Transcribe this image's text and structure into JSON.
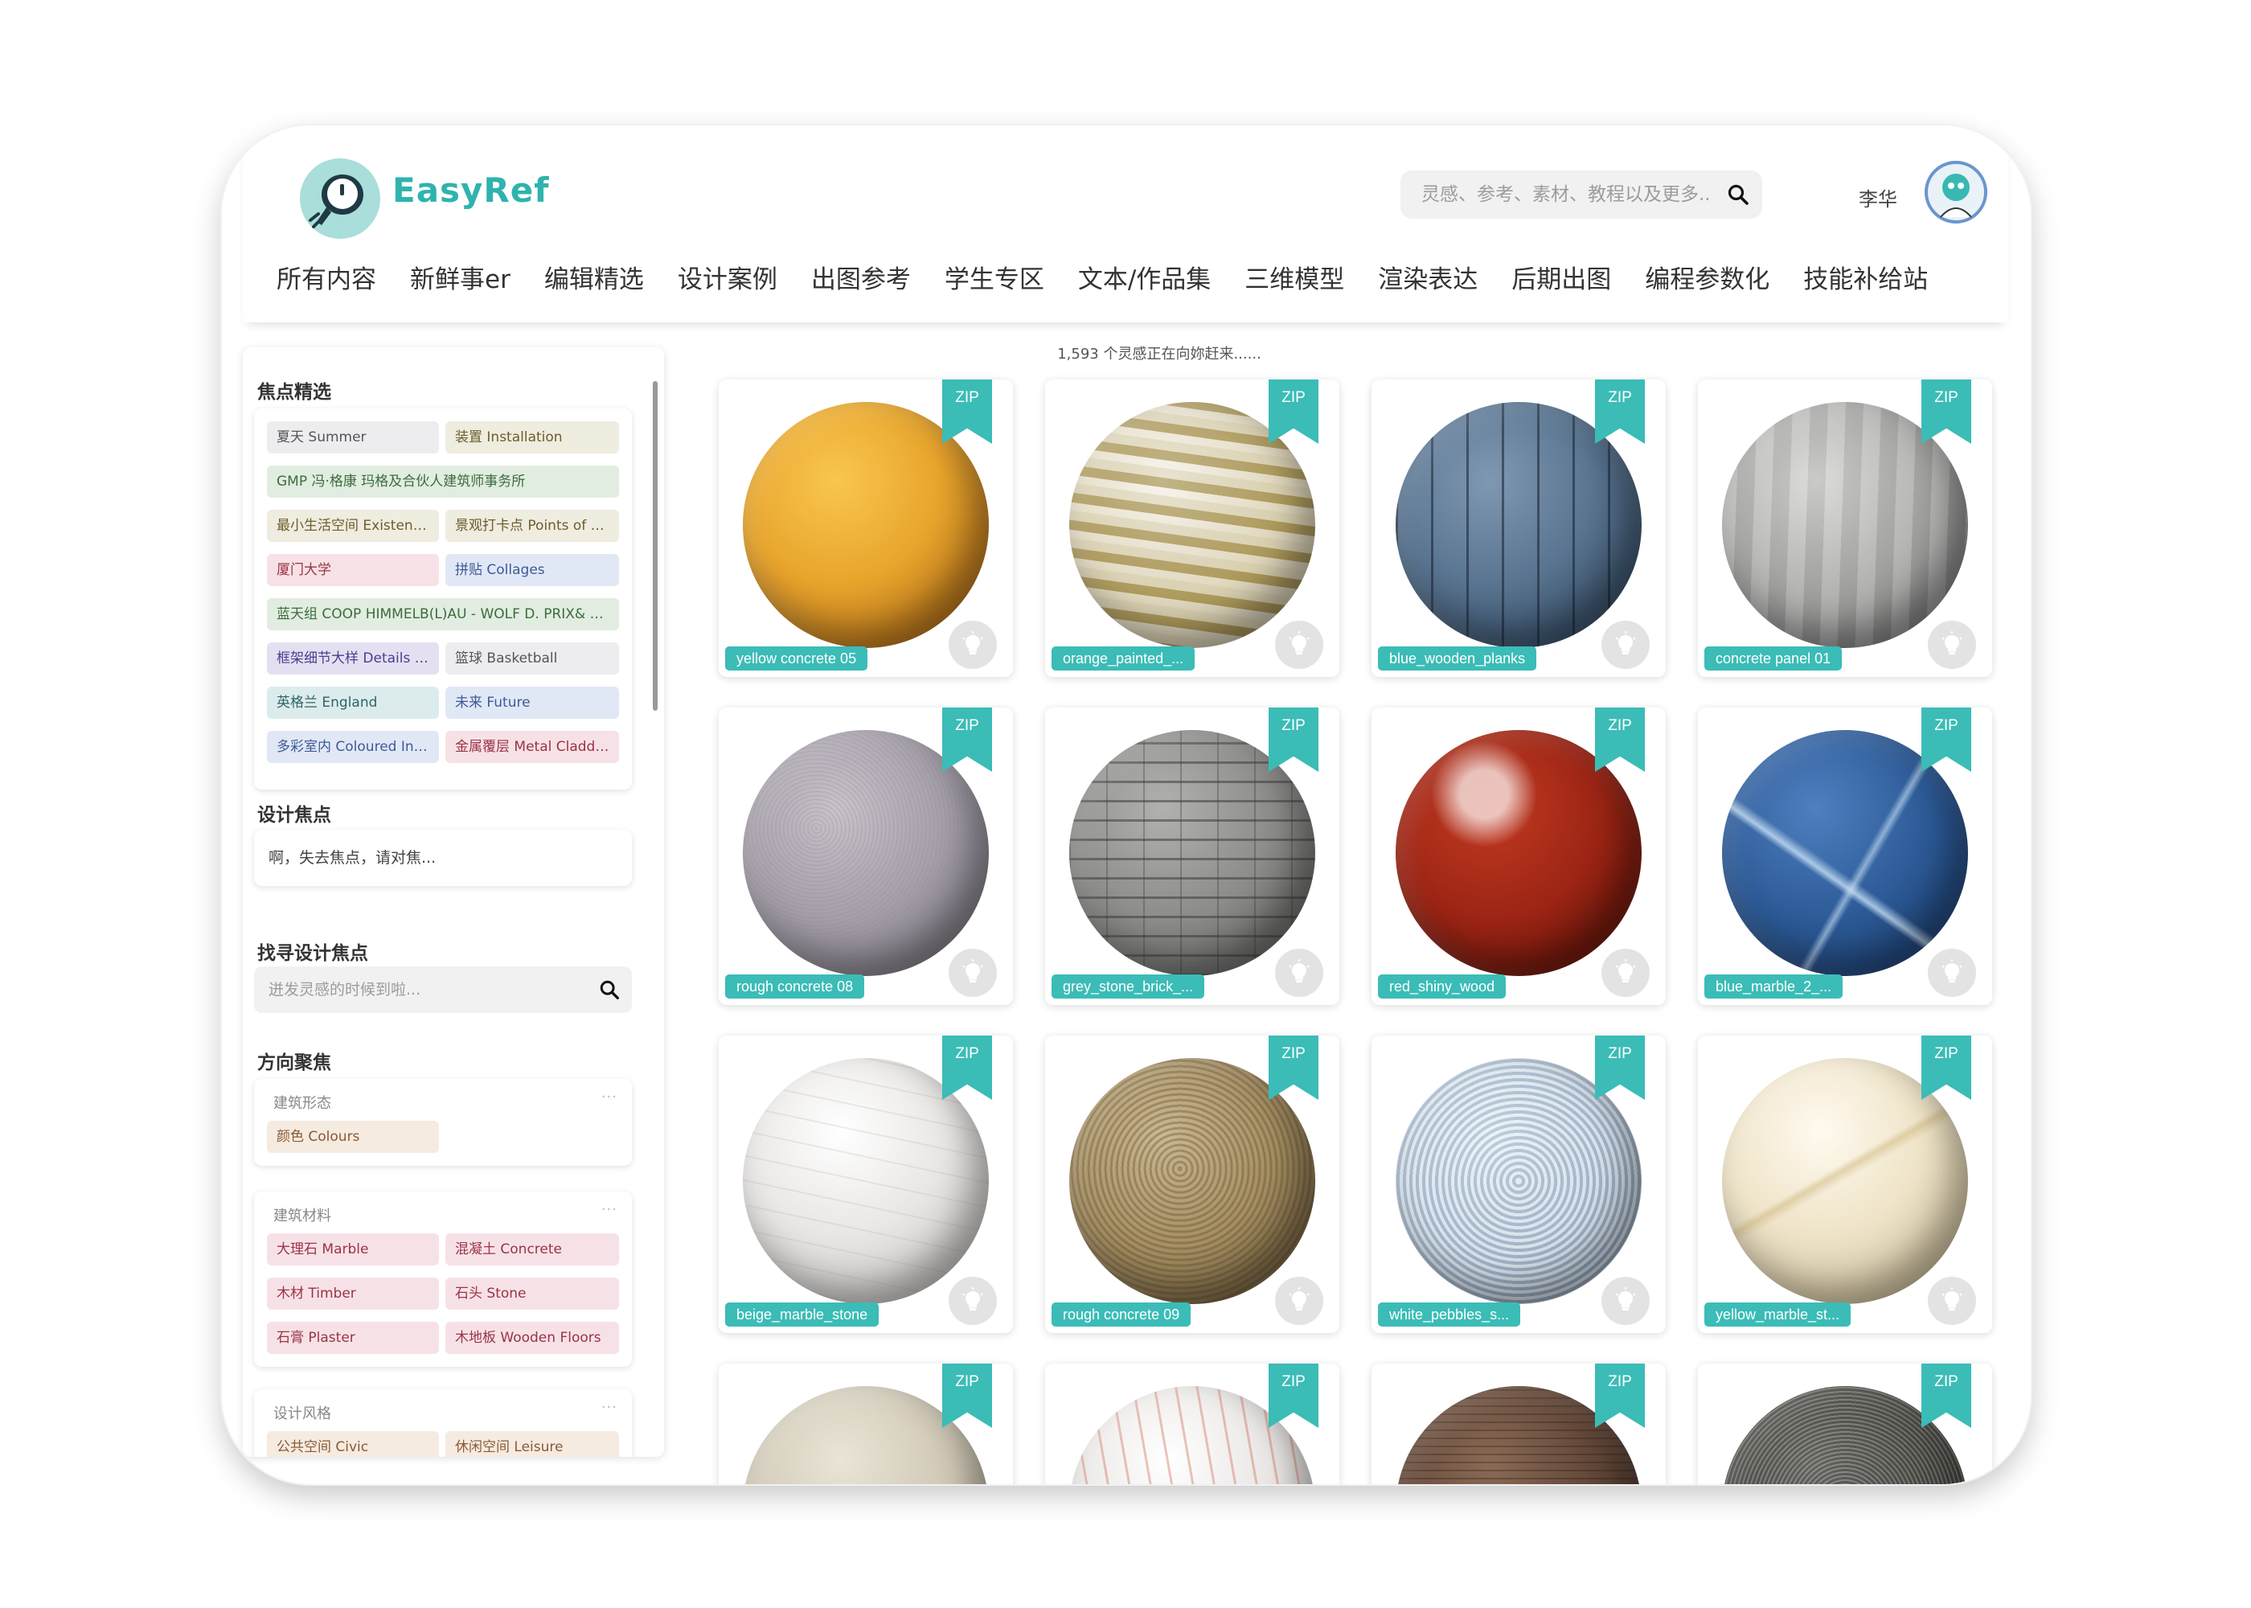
{
  "header": {
    "brand": "EasyRef",
    "search_placeholder": "灵感、参考、素材、教程以及更多...",
    "username": "李华",
    "nav": [
      "所有内容",
      "新鲜事er",
      "编辑精选",
      "设计案例",
      "出图参考",
      "学生专区",
      "文本/作品集",
      "三维模型",
      "渲染表达",
      "后期出图",
      "编程参数化",
      "技能补给站"
    ]
  },
  "sidebar": {
    "featured_title": "焦点精选",
    "featured_tags": [
      {
        "label": "夏天 Summer",
        "color": "gray"
      },
      {
        "label": "装置 Installation",
        "color": "beige"
      },
      {
        "label": "GMP 冯·格康 玛格及合伙人建筑师事务所",
        "color": "green"
      },
      {
        "label": "最小生活空间 Existenz...",
        "color": "beige"
      },
      {
        "label": "景观打卡点 Points of Vi...",
        "color": "beige"
      },
      {
        "label": "厦门大学",
        "color": "pink"
      },
      {
        "label": "拼贴 Collages",
        "color": "blue"
      },
      {
        "label": "蓝天组 COOP HIMMELB(L)AU - WOLF D. PRIX& PART...",
        "color": "green"
      },
      {
        "label": "框架细节大样 Details of...",
        "color": "purple"
      },
      {
        "label": "篮球 Basketball",
        "color": "gray"
      },
      {
        "label": "英格兰 England",
        "color": "teal"
      },
      {
        "label": "未来 Future",
        "color": "blue"
      },
      {
        "label": "多彩室内 Coloured Inte...",
        "color": "blue"
      },
      {
        "label": "金属覆层 Metal Claddin...",
        "color": "pink"
      }
    ],
    "focus_title": "设计焦点",
    "focus_text": "啊，失去焦点，请对焦...",
    "find_title": "找寻设计焦点",
    "find_placeholder": "迸发灵感的时候到啦...",
    "direction_title": "方向聚焦",
    "groups": [
      {
        "title": "建筑形态",
        "tags": [
          {
            "label": "颜色 Colours",
            "color": "skin"
          }
        ]
      },
      {
        "title": "建筑材料",
        "tags": [
          {
            "label": "大理石 Marble",
            "color": "pink"
          },
          {
            "label": "混凝土 Concrete",
            "color": "pink"
          },
          {
            "label": "木材 Timber",
            "color": "pink"
          },
          {
            "label": "石头 Stone",
            "color": "pink"
          },
          {
            "label": "石膏 Plaster",
            "color": "pink"
          },
          {
            "label": "木地板 Wooden Floors",
            "color": "pink"
          }
        ]
      },
      {
        "title": "设计风格",
        "tags": [
          {
            "label": "公共空间 Civic",
            "color": "skin"
          },
          {
            "label": "休闲空间 Leisure",
            "color": "skin"
          }
        ]
      }
    ],
    "more_label": "···"
  },
  "main": {
    "count_text": "1,593 个灵感正在向妳赶来......",
    "zip_label": "ZIP",
    "cards": [
      {
        "label": "yellow concrete 05",
        "material": "yellow-concrete"
      },
      {
        "label": "orange_painted_...",
        "material": "orange-painted"
      },
      {
        "label": "blue_wooden_planks",
        "material": "blue-planks"
      },
      {
        "label": "concrete panel 01",
        "material": "concrete-panel"
      },
      {
        "label": "rough concrete 08",
        "material": "rough-concrete"
      },
      {
        "label": "grey_stone_brick_...",
        "material": "stone-brick"
      },
      {
        "label": "red_shiny_wood",
        "material": "red-wood"
      },
      {
        "label": "blue_marble_2_...",
        "material": "blue-marble"
      },
      {
        "label": "beige_marble_stone",
        "material": "beige-marble"
      },
      {
        "label": "rough concrete 09",
        "material": "rough-concrete-09"
      },
      {
        "label": "white_pebbles_s...",
        "material": "white-pebbles"
      },
      {
        "label": "yellow_marble_st...",
        "material": "yellow-marble"
      },
      {
        "label": "",
        "material": "beige-plain"
      },
      {
        "label": "",
        "material": "white-red-marble"
      },
      {
        "label": "",
        "material": "brown-wood"
      },
      {
        "label": "",
        "material": "dark-gravel"
      }
    ]
  }
}
